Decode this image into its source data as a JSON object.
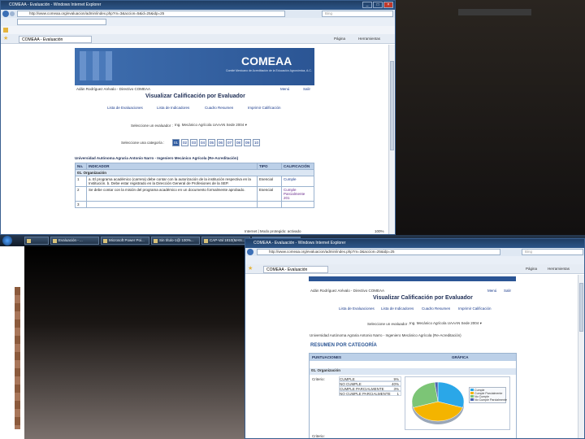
{
  "top_window": {
    "title": "COMEAA - Evaluación - Windows Internet Explorer",
    "address": "http://www.comeaa.org/evaluacion/admin/index.php?m=3&accion=5&id=25&idp=25",
    "search_placeholder": "Bing",
    "tab_label": "COMEAA - Evaluación",
    "toolbar_page": "Página",
    "toolbar_tools": "Herramientas",
    "logo_text": "COMEAA",
    "logo_subtitle": "Comité Mexicano de Acreditación de la Educación Agronómica, A.C.",
    "user_line": "Adán Rodríguez Arévalo - Directivo COMEAA",
    "menu_label": "Menú",
    "exit_label": "Salir",
    "page_title": "Visualizar Calificación por Evaluador",
    "nav_links": [
      "Lista de Evaluaciones",
      "Lista de Indicadores",
      "Cuadro Resumen",
      "Imprimir Calificación"
    ],
    "evaluator_label": "Seleccione un evaluador :",
    "evaluator_value": "Ing. Mecánico Agrícola UAAAN Sede 2004",
    "category_label": "Seleccione una categoría :",
    "categories": [
      "01",
      "02",
      "03",
      "04",
      "05",
      "06",
      "07",
      "08",
      "09",
      "10"
    ],
    "selected_category": "01",
    "institution": "Universidad Autónoma Agraria Antonio Narro - Ingeniero Mecánico Agrícola (Re-Acreditación)",
    "table_headers": [
      "No.",
      "INDICADOR",
      "TIPO",
      "CALIFICACIÓN"
    ],
    "category_row": "01. Organización",
    "rows": [
      {
        "no": "1",
        "indicador": "a. El programa académico (carrera) debe contar con la autorización de la institución respectiva en la Institución.   b. Debe estar registrado en la Dirección General de Profesiones de la SEP.",
        "tipo": "Esencial",
        "calificacion": "Cumple"
      },
      {
        "no": "2",
        "indicador": "Se debe contar con la misión del programa académico en un documento formalmente aprobado.",
        "tipo": "Esencial",
        "calificacion": "Cumple Parcialmente 201"
      },
      {
        "no": "3",
        "indicador": "",
        "tipo": "",
        "calificacion": ""
      }
    ],
    "status_text": "Internet | Modo protegido: activado",
    "zoom": "100%"
  },
  "taskbar": {
    "items": [
      "",
      "Evaluación - ...",
      "Microsoft Power Poi...",
      "Sin título-1@ 100%...",
      "CAP-Val 1810(MAN...",
      "COMEAA - Evalua..."
    ]
  },
  "bottom_window": {
    "title": "COMEAA - Evaluación - Windows Internet Explorer",
    "address": "http://www.comeaa.org/evaluacion/admin/index.php?m=3&accion=25&idp=25",
    "search_placeholder": "Bing",
    "tab_label": "COMEAA - Evaluación",
    "toolbar_page": "Página",
    "toolbar_tools": "Herramientas",
    "user_line": "Adán Rodríguez Arévalo - Directivo COMEAA",
    "menu_label": "Menú",
    "exit_label": "Salir",
    "page_title": "Visualizar Calificación por Evaluador",
    "nav_links": [
      "Lista de Evaluaciones",
      "Lista de Indicadores",
      "Cuadro Resumen",
      "Imprimir Calificación"
    ],
    "evaluator_label": "Seleccione un evaluador :",
    "evaluator_value": "Ing. Mecánico Agrícola UAAAN Sede 2004",
    "institution": "Universidad Autónoma Agraria Antonio Narro - Ingeniero Mecánico Agrícola (Re-Acreditación)",
    "summary_title": "RESUMEN POR CATEGORÍA",
    "summary_headers": [
      "PUNTUACIONES",
      "GRÁFICA"
    ],
    "category_row": "01. Organización",
    "criteria_label": "Criterio:",
    "scores": [
      {
        "label": "CUMPLE",
        "value": "9%"
      },
      {
        "label": "NO CUMPLE",
        "value": "40%"
      },
      {
        "label": "CUMPLE PARCIALMENTE",
        "value": "3%"
      },
      {
        "label": "NO CUMPLE PARCIALMENTE",
        "value": "1"
      }
    ],
    "legend": [
      "Cumple",
      "Cumple Parcialmente",
      "No Cumple",
      "No Cumple Parcialmente"
    ],
    "pie_colors": [
      "#2aa7e8",
      "#f4b400",
      "#7cc576",
      "#4a64b0"
    ],
    "pie_fractions": [
      0.3,
      0.4,
      0.28,
      0.02
    ],
    "tip_label": "Criterio:"
  }
}
